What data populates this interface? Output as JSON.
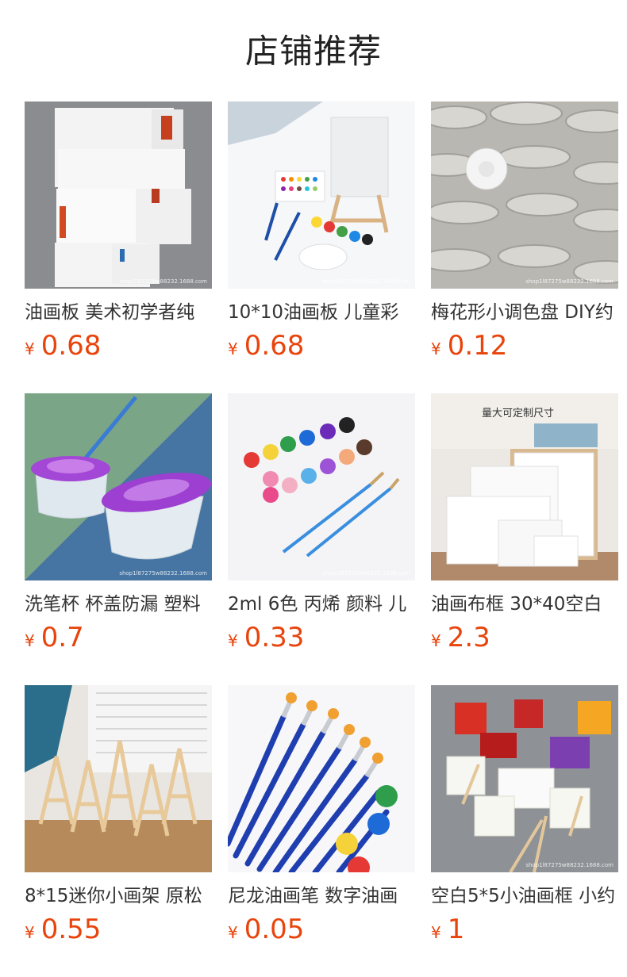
{
  "header": {
    "title": "店铺推荐"
  },
  "products": [
    {
      "name": "油画板 美术初学者纯",
      "currency": "¥",
      "price": "0.68",
      "image_icon": "canvas-boards-photo",
      "watermark": "shop1l87275w88232.1688.com"
    },
    {
      "name": "10*10油画板 儿童彩",
      "currency": "¥",
      "price": "0.68",
      "image_icon": "mini-canvas-kit-photo",
      "watermark": "shop1l87275w88232.1688.com"
    },
    {
      "name": "梅花形小调色盘 DIY约",
      "currency": "¥",
      "price": "0.12",
      "image_icon": "palette-stack-photo",
      "watermark": "shop1l87275w88232.1688.com"
    },
    {
      "name": "洗笔杯 杯盖防漏 塑料",
      "currency": "¥",
      "price": "0.7",
      "image_icon": "brush-wash-cup-photo",
      "watermark": "shop1l87275w88232.1688.com"
    },
    {
      "name": "2ml 6色 丙烯 颜料 儿",
      "currency": "¥",
      "price": "0.33",
      "image_icon": "paint-pots-photo",
      "watermark": "shop1l87275w88232.1688.com"
    },
    {
      "name": "油画布框 30*40空白",
      "currency": "¥",
      "price": "2.3",
      "image_icon": "canvas-frames-photo",
      "watermark": "",
      "overlay_text": "量大可定制尺寸"
    },
    {
      "name": "8*15迷你小画架 原松",
      "currency": "¥",
      "price": "0.55",
      "image_icon": "mini-easels-photo",
      "watermark": ""
    },
    {
      "name": "尼龙油画笔 数字油画",
      "currency": "¥",
      "price": "0.05",
      "image_icon": "nylon-brushes-photo",
      "watermark": ""
    },
    {
      "name": "空白5*5小油画框 小约",
      "currency": "¥",
      "price": "1",
      "image_icon": "mini-canvas-easels-photo",
      "watermark": "shop1l87275w88232.1688.com"
    }
  ],
  "colors": {
    "price": "#e8440c",
    "title": "#222222",
    "text": "#333333"
  }
}
